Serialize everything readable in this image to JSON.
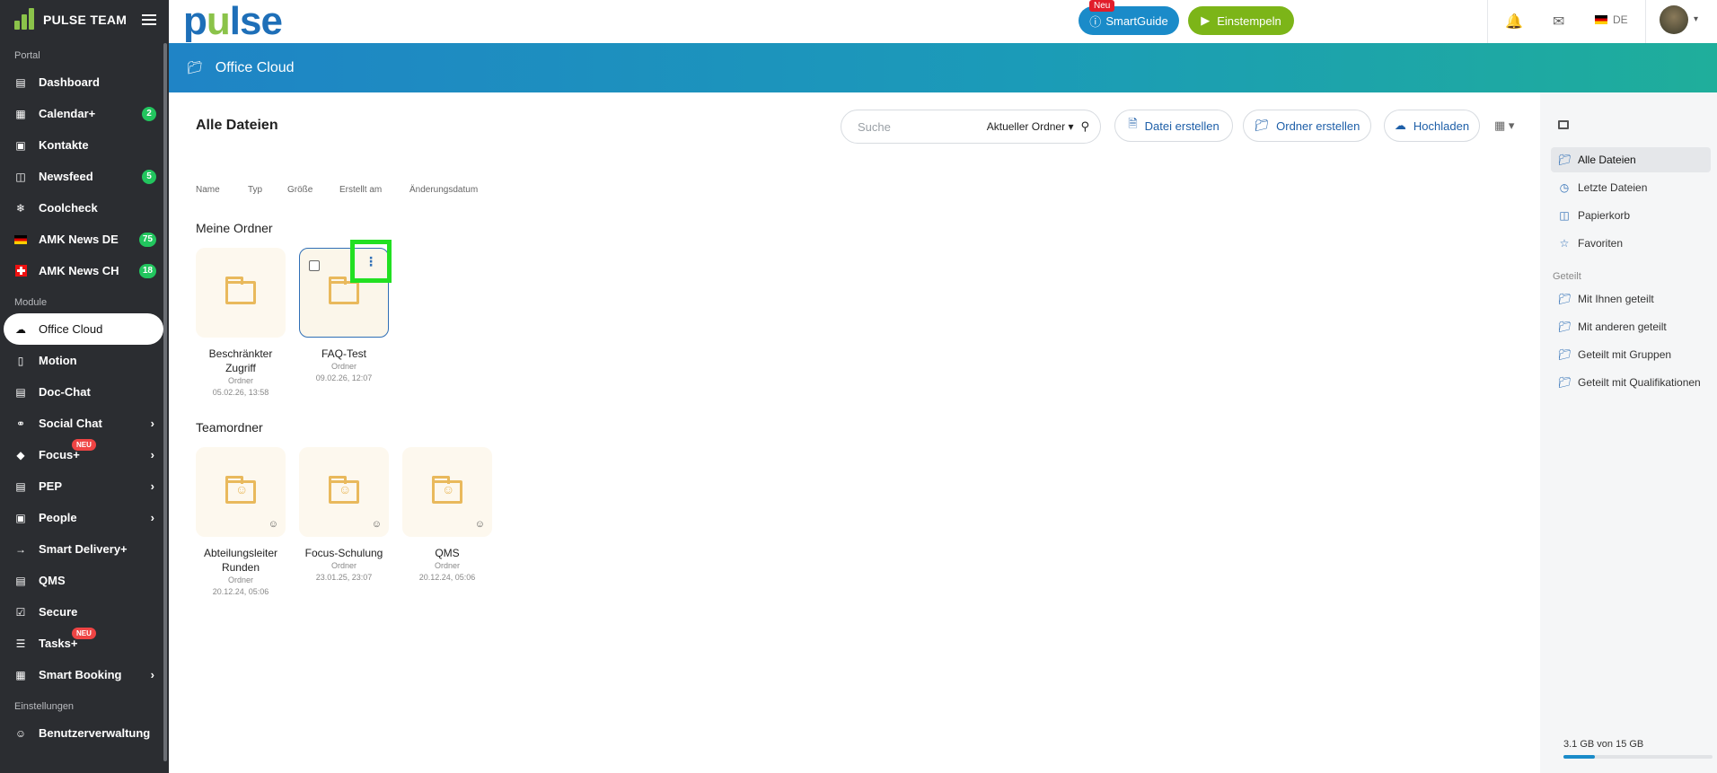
{
  "sidebar": {
    "team": "PULSE TEAM",
    "sections": {
      "portal": "Portal",
      "module": "Module",
      "einstellungen": "Einstellungen"
    },
    "portal_items": [
      {
        "label": "Dashboard",
        "icon": "dashboard-icon"
      },
      {
        "label": "Calendar+",
        "icon": "calendar-icon",
        "badge": "2"
      },
      {
        "label": "Kontakte",
        "icon": "contacts-icon"
      },
      {
        "label": "Newsfeed",
        "icon": "newsfeed-icon",
        "badge": "5"
      },
      {
        "label": "Coolcheck",
        "icon": "coolcheck-icon"
      },
      {
        "label": "AMK News DE",
        "icon": "flag-de-icon",
        "badge": "75"
      },
      {
        "label": "AMK News CH",
        "icon": "flag-ch-icon",
        "badge": "18"
      }
    ],
    "module_items": [
      {
        "label": "Office Cloud",
        "icon": "cloud-icon"
      },
      {
        "label": "Motion",
        "icon": "motion-icon"
      },
      {
        "label": "Doc-Chat",
        "icon": "chat-icon"
      },
      {
        "label": "Social Chat",
        "icon": "share-icon"
      },
      {
        "label": "Focus+",
        "icon": "graduation-icon",
        "neu": "NEU"
      },
      {
        "label": "PEP",
        "icon": "pep-icon"
      },
      {
        "label": "People",
        "icon": "people-icon"
      },
      {
        "label": "Smart Delivery+",
        "icon": "arrow-right-icon"
      },
      {
        "label": "QMS",
        "icon": "qms-icon"
      },
      {
        "label": "Secure",
        "icon": "secure-icon"
      },
      {
        "label": "Tasks+",
        "icon": "tasks-icon",
        "neu": "NEU"
      },
      {
        "label": "Smart Booking",
        "icon": "booking-icon"
      }
    ],
    "settings_items": [
      {
        "label": "Benutzerverwaltung",
        "icon": "users-icon"
      }
    ]
  },
  "topbar": {
    "brand": "pulse",
    "smartguide": "SmartGuide",
    "smartguide_badge": "Neu",
    "einstempeln": "Einstempeln",
    "lang": "DE"
  },
  "banner": {
    "title": "Office Cloud"
  },
  "main": {
    "title": "Alle Dateien",
    "search_placeholder": "Suche",
    "search_scope": "Aktueller Ordner",
    "btn_datei": "Datei erstellen",
    "btn_ordner": "Ordner erstellen",
    "btn_upload": "Hochladen",
    "columns": [
      "Name",
      "Typ",
      "Größe",
      "Erstellt am",
      "Änderungsdatum"
    ],
    "groups": {
      "meine": "Meine Ordner",
      "team": "Teamordner"
    },
    "meine_folders": [
      {
        "name": "Beschränkter Zugriff",
        "type": "Ordner",
        "date": "05.02.26, 13:58"
      },
      {
        "name": "FAQ-Test",
        "type": "Ordner",
        "date": "09.02.26, 12:07"
      }
    ],
    "team_folders": [
      {
        "name": "Abteilungsleiter Runden",
        "type": "Ordner",
        "date": "20.12.24, 05:06"
      },
      {
        "name": "Focus-Schulung",
        "type": "Ordner",
        "date": "23.01.25, 23:07"
      },
      {
        "name": "QMS",
        "type": "Ordner",
        "date": "20.12.24, 05:06"
      }
    ]
  },
  "rpanel": {
    "items": [
      {
        "label": "Alle Dateien",
        "icon": "folder-icon"
      },
      {
        "label": "Letzte Dateien",
        "icon": "clock-icon"
      },
      {
        "label": "Papierkorb",
        "icon": "trash-icon"
      },
      {
        "label": "Favoriten",
        "icon": "star-icon"
      }
    ],
    "shared_title": "Geteilt",
    "shared_items": [
      {
        "label": "Mit Ihnen geteilt",
        "icon": "folder-shared-icon"
      },
      {
        "label": "Mit anderen geteilt",
        "icon": "folder-shared-icon"
      },
      {
        "label": "Geteilt mit Gruppen",
        "icon": "folder-shared-icon"
      },
      {
        "label": "Geteilt mit Qualifikationen",
        "icon": "folder-shared-icon"
      }
    ],
    "storage": "3.1 GB von 15 GB",
    "storage_fraction": 0.21
  },
  "colors": {
    "sidebar_bg": "#2b2d31",
    "brand_blue": "#1e6fb8",
    "brand_green": "#8bc34a",
    "smartguide": "#1a8bc9",
    "einstempeln": "#7cb518",
    "highlight": "#22e022"
  }
}
